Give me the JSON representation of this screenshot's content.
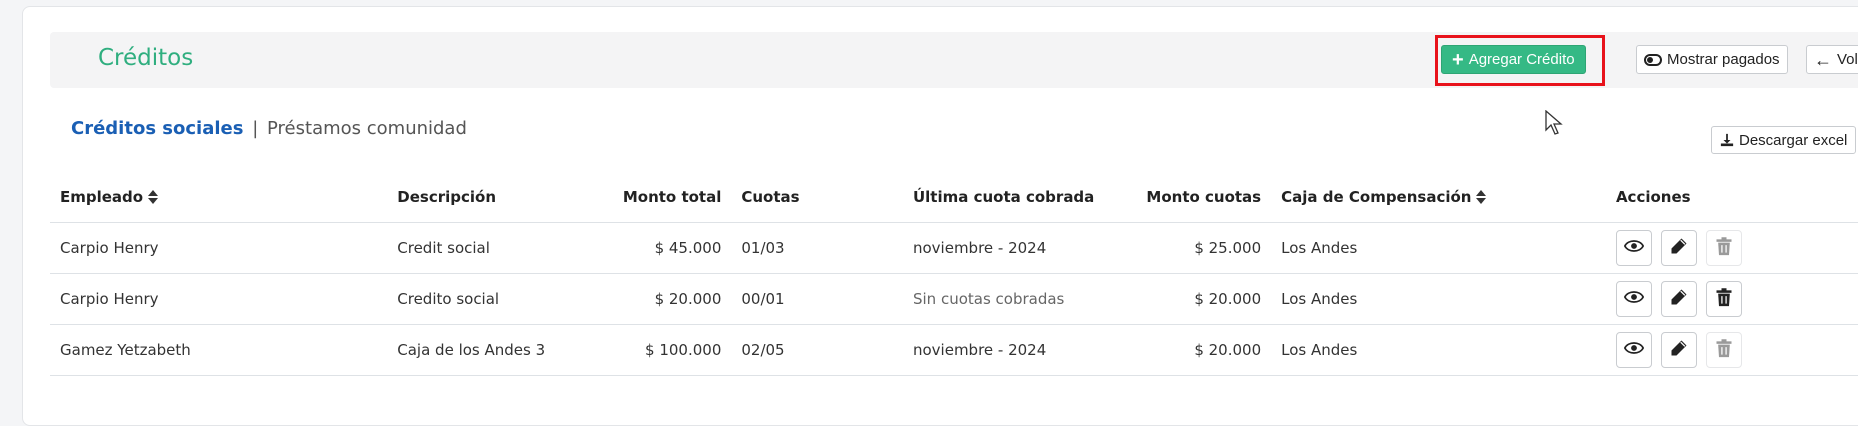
{
  "header": {
    "title": "Créditos",
    "add_label": "Agregar Crédito",
    "show_paid_label": "Mostrar pagados",
    "back_label": "Volver"
  },
  "subnav": {
    "active": "Créditos sociales",
    "separator": "|",
    "inactive": "Préstamos comunidad"
  },
  "download_label": "Descargar excel",
  "table": {
    "columns": [
      "Empleado",
      "Descripción",
      "Monto total",
      "Cuotas",
      "Última cuota cobrada",
      "Monto cuotas",
      "Caja de Compensación",
      "Acciones"
    ],
    "rows": [
      {
        "empleado": "Carpio Henry",
        "descripcion": "Credit social",
        "monto_total": "$ 45.000",
        "cuotas": "01/03",
        "ultima_cuota": "noviembre - 2024",
        "monto_cuotas": "$ 25.000",
        "caja": "Los Andes",
        "delete_enabled": false
      },
      {
        "empleado": "Carpio Henry",
        "descripcion": "Credito social",
        "monto_total": "$ 20.000",
        "cuotas": "00/01",
        "ultima_cuota": "Sin cuotas cobradas",
        "monto_cuotas": "$ 20.000",
        "caja": "Los Andes",
        "delete_enabled": true
      },
      {
        "empleado": "Gamez Yetzabeth",
        "descripcion": "Caja de los Andes 3",
        "monto_total": "$ 100.000",
        "cuotas": "02/05",
        "ultima_cuota": "noviembre - 2024",
        "monto_cuotas": "$ 20.000",
        "caja": "Los Andes",
        "delete_enabled": false
      }
    ]
  },
  "colors": {
    "title": "#2fae7f",
    "primary_button": "#35b985",
    "active_tab": "#1a5fb4",
    "highlight_box": "#e8121b"
  },
  "icons": [
    "plus-icon",
    "eye-icon",
    "arrow-left-icon",
    "download-icon",
    "sort-icon",
    "view-icon",
    "edit-icon",
    "trash-icon",
    "mouse-cursor-icon"
  ]
}
